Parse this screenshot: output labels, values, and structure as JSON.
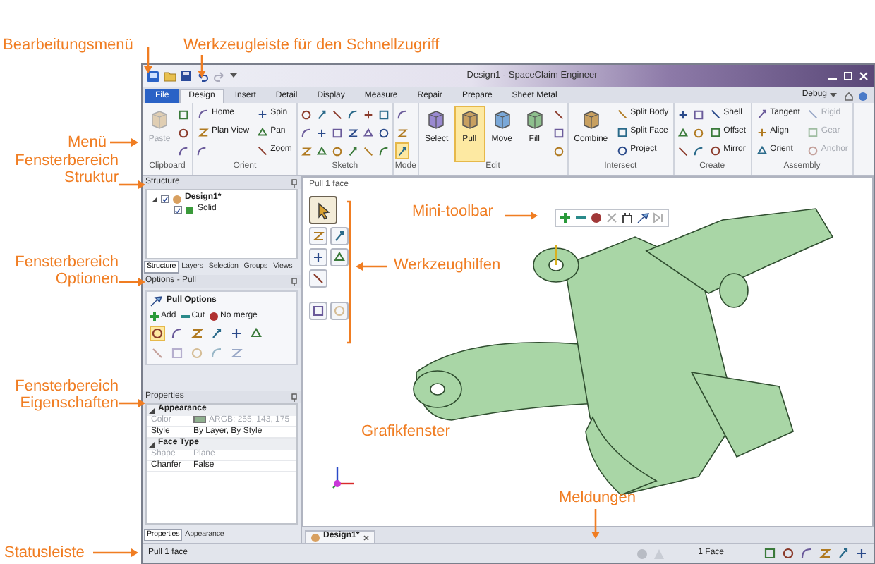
{
  "callouts": [
    "Bearbeitungsmenü",
    "Werkzeugleiste für den Schnellzugriff",
    "Menü",
    "Fensterbereich Struktur",
    "Fensterbereich Optionen",
    "Fensterbereich Eigenschaften",
    "Statusleiste",
    "Mini-toolbar",
    "Werkzeughilfen",
    "Grafikfenster",
    "Meldungen"
  ],
  "window": {
    "title": "Design1 - SpaceClaim Engineer"
  },
  "ribbon_tabs": [
    {
      "label": "File",
      "kind": "file",
      "selected": false
    },
    {
      "label": "Design",
      "kind": "tab",
      "selected": true
    },
    {
      "label": "Insert",
      "kind": "tab",
      "selected": false
    },
    {
      "label": "Detail",
      "kind": "tab",
      "selected": false
    },
    {
      "label": "Display",
      "kind": "tab",
      "selected": false
    },
    {
      "label": "Measure",
      "kind": "tab",
      "selected": false
    },
    {
      "label": "Repair",
      "kind": "tab",
      "selected": false
    },
    {
      "label": "Prepare",
      "kind": "tab",
      "selected": false
    },
    {
      "label": "Sheet Metal",
      "kind": "tab",
      "selected": false
    }
  ],
  "ribbon_menu": {
    "label": "Debug"
  },
  "ribbon_groups": [
    {
      "label": "Clipboard",
      "items": [
        {
          "kind": "large",
          "label": "Paste",
          "active": false,
          "disabled": true
        },
        {
          "kind": "icon",
          "active": false,
          "disabled": false
        },
        {
          "kind": "icon",
          "active": false,
          "disabled": false
        },
        {
          "kind": "icon",
          "active": false,
          "disabled": false
        }
      ]
    },
    {
      "label": "Orient",
      "items": [
        {
          "kind": "small",
          "label": "Home",
          "active": false,
          "disabled": false
        },
        {
          "kind": "small",
          "label": "Plan View",
          "active": false,
          "disabled": false
        },
        {
          "kind": "icon",
          "active": false,
          "disabled": false
        },
        {
          "kind": "small",
          "label": "Spin",
          "active": false,
          "disabled": false
        },
        {
          "kind": "small",
          "label": "Pan",
          "active": false,
          "disabled": false
        },
        {
          "kind": "small",
          "label": "Zoom",
          "active": false,
          "disabled": false
        }
      ]
    },
    {
      "label": "Sketch",
      "items": [
        {
          "kind": "icon",
          "active": false,
          "disabled": false
        },
        {
          "kind": "icon",
          "active": false,
          "disabled": false
        },
        {
          "kind": "icon",
          "active": false,
          "disabled": false
        },
        {
          "kind": "icon",
          "active": false,
          "disabled": false
        },
        {
          "kind": "icon",
          "active": false,
          "disabled": false
        },
        {
          "kind": "icon",
          "active": false,
          "disabled": false
        },
        {
          "kind": "icon",
          "active": false,
          "disabled": false
        },
        {
          "kind": "icon",
          "active": false,
          "disabled": false
        },
        {
          "kind": "icon",
          "active": false,
          "disabled": false
        },
        {
          "kind": "icon",
          "active": false,
          "disabled": false
        },
        {
          "kind": "icon",
          "active": false,
          "disabled": false
        },
        {
          "kind": "icon",
          "active": false,
          "disabled": false
        },
        {
          "kind": "icon",
          "active": false,
          "disabled": false
        },
        {
          "kind": "icon",
          "active": false,
          "disabled": false
        },
        {
          "kind": "icon",
          "active": false,
          "disabled": false
        },
        {
          "kind": "icon",
          "active": false,
          "disabled": false
        },
        {
          "kind": "icon",
          "active": false,
          "disabled": false
        },
        {
          "kind": "icon",
          "active": false,
          "disabled": false
        }
      ]
    },
    {
      "label": "Mode",
      "items": [
        {
          "kind": "icon",
          "active": false,
          "disabled": false
        },
        {
          "kind": "icon",
          "active": false,
          "disabled": false
        },
        {
          "kind": "icon",
          "active": true,
          "disabled": false
        }
      ]
    },
    {
      "label": "Edit",
      "items": [
        {
          "kind": "large",
          "label": "Select",
          "active": false,
          "disabled": false
        },
        {
          "kind": "large",
          "label": "Pull",
          "active": true,
          "disabled": false
        },
        {
          "kind": "large",
          "label": "Move",
          "active": false,
          "disabled": false
        },
        {
          "kind": "large",
          "label": "Fill",
          "active": false,
          "disabled": false
        },
        {
          "kind": "icon",
          "active": false,
          "disabled": false
        },
        {
          "kind": "icon",
          "active": false,
          "disabled": false
        },
        {
          "kind": "icon",
          "active": false,
          "disabled": false
        }
      ]
    },
    {
      "label": "Intersect",
      "items": [
        {
          "kind": "large",
          "label": "Combine",
          "active": false,
          "disabled": false
        },
        {
          "kind": "small",
          "label": "Split Body",
          "active": false,
          "disabled": false
        },
        {
          "kind": "small",
          "label": "Split Face",
          "active": false,
          "disabled": false
        },
        {
          "kind": "small",
          "label": "Project",
          "active": false,
          "disabled": false
        }
      ]
    },
    {
      "label": "Create",
      "items": [
        {
          "kind": "icon",
          "active": false,
          "disabled": false
        },
        {
          "kind": "icon",
          "active": false,
          "disabled": false
        },
        {
          "kind": "icon",
          "active": false,
          "disabled": false
        },
        {
          "kind": "icon",
          "active": false,
          "disabled": false
        },
        {
          "kind": "icon",
          "active": false,
          "disabled": false
        },
        {
          "kind": "icon",
          "active": false,
          "disabled": false
        },
        {
          "kind": "small",
          "label": "Shell",
          "active": false,
          "disabled": false
        },
        {
          "kind": "small",
          "label": "Offset",
          "active": false,
          "disabled": false
        },
        {
          "kind": "small",
          "label": "Mirror",
          "active": false,
          "disabled": false
        }
      ]
    },
    {
      "label": "Assembly",
      "items": [
        {
          "kind": "small",
          "label": "Tangent",
          "active": false,
          "disabled": false
        },
        {
          "kind": "small",
          "label": "Align",
          "active": false,
          "disabled": false
        },
        {
          "kind": "small",
          "label": "Orient",
          "active": false,
          "disabled": false
        },
        {
          "kind": "small",
          "label": "Rigid",
          "active": false,
          "disabled": true
        },
        {
          "kind": "small",
          "label": "Gear",
          "active": false,
          "disabled": true
        },
        {
          "kind": "small",
          "label": "Anchor",
          "active": false,
          "disabled": true
        }
      ]
    }
  ],
  "structure": {
    "title": "Structure",
    "tree": [
      {
        "label": "Design1*",
        "checked": true,
        "expanded": true,
        "children": [
          {
            "label": "Solid",
            "checked": true
          }
        ]
      }
    ],
    "tabs": [
      {
        "label": "Structure",
        "selected": true
      },
      {
        "label": "Layers",
        "selected": false
      },
      {
        "label": "Selection",
        "selected": false
      },
      {
        "label": "Groups",
        "selected": false
      },
      {
        "label": "Views",
        "selected": false
      }
    ]
  },
  "options": {
    "title": "Options - Pull",
    "heading": "Pull Options",
    "modes": [
      {
        "label": "Add",
        "kind": "add"
      },
      {
        "label": "Cut",
        "kind": "cut"
      },
      {
        "label": "No merge",
        "kind": "nomerge"
      }
    ],
    "buttons": [
      {
        "selected": true,
        "disabled": false
      },
      {
        "selected": false,
        "disabled": false
      },
      {
        "selected": false,
        "disabled": false
      },
      {
        "selected": false,
        "disabled": false
      },
      {
        "selected": false,
        "disabled": false
      },
      {
        "selected": false,
        "disabled": false
      },
      {
        "selected": false,
        "disabled": true
      },
      {
        "selected": false,
        "disabled": true
      },
      {
        "selected": false,
        "disabled": true
      },
      {
        "selected": false,
        "disabled": true
      },
      {
        "selected": false,
        "disabled": true
      }
    ]
  },
  "properties": {
    "title": "Properties",
    "groups": [
      {
        "label": "Appearance",
        "expanded": true,
        "rows": [
          {
            "name": "Color",
            "value": "ARGB: 255, 143, 175",
            "color": "#8fb08f",
            "disabled": true
          },
          {
            "name": "Style",
            "value": "By Layer, By Style",
            "disabled": false
          }
        ]
      },
      {
        "label": "Face Type",
        "expanded": true,
        "rows": [
          {
            "name": "Shape",
            "value": "Plane",
            "disabled": true
          },
          {
            "name": "Chanfer",
            "value": "False",
            "disabled": false
          }
        ]
      }
    ],
    "tabs": [
      {
        "label": "Properties",
        "selected": true
      },
      {
        "label": "Appearance",
        "selected": false
      }
    ]
  },
  "graphics": {
    "caption": "Pull 1 face",
    "tool_guides": [
      {
        "selected": true,
        "disabled": false
      },
      {
        "selected": false,
        "disabled": false
      },
      {
        "selected": false,
        "disabled": false
      },
      {
        "selected": false,
        "disabled": false
      },
      {
        "selected": false,
        "disabled": false
      },
      {
        "selected": false,
        "disabled": false
      },
      {
        "selected": false,
        "disabled": false
      },
      {
        "selected": false,
        "disabled": true
      }
    ],
    "doc_tabs": [
      {
        "label": "Design1*",
        "selected": true
      }
    ]
  },
  "status_bar": {
    "text": "Pull 1 face",
    "selection": "1 Face"
  }
}
